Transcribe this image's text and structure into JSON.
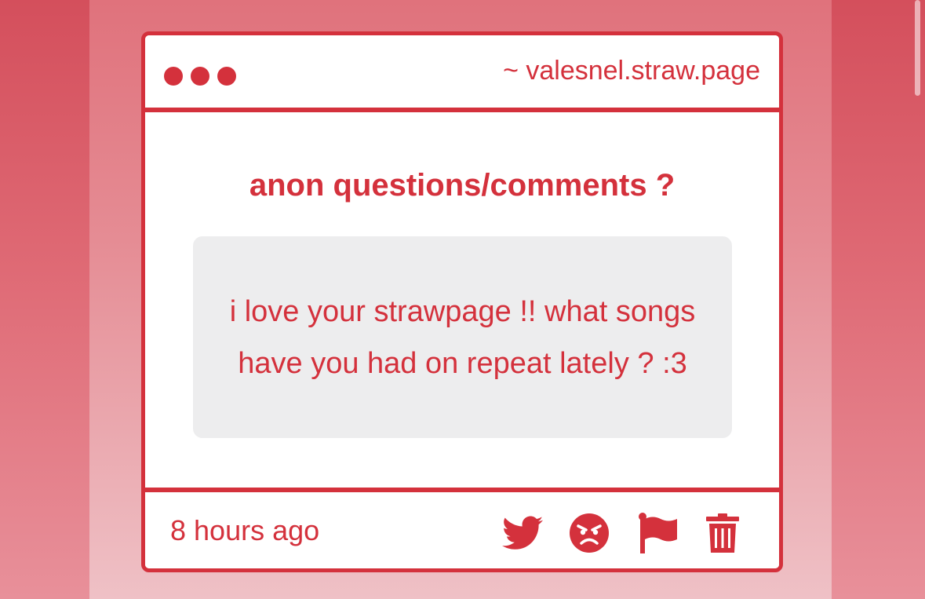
{
  "page": {
    "url": "~ valesnel.straw.page"
  },
  "question": {
    "title": "anon questions/comments ?",
    "message": "i love your strawpage !! what songs have you had on repeat lately ? :3"
  },
  "footer": {
    "timestamp": "8 hours ago",
    "actions": [
      {
        "icon": "twitter-icon",
        "label": "share on twitter"
      },
      {
        "icon": "angry-face-icon",
        "label": "block"
      },
      {
        "icon": "flag-icon",
        "label": "report"
      },
      {
        "icon": "trash-icon",
        "label": "delete"
      }
    ]
  },
  "colors": {
    "accent": "#d4313c",
    "message_bg": "#ededee",
    "page_bg": "#e0727c"
  }
}
